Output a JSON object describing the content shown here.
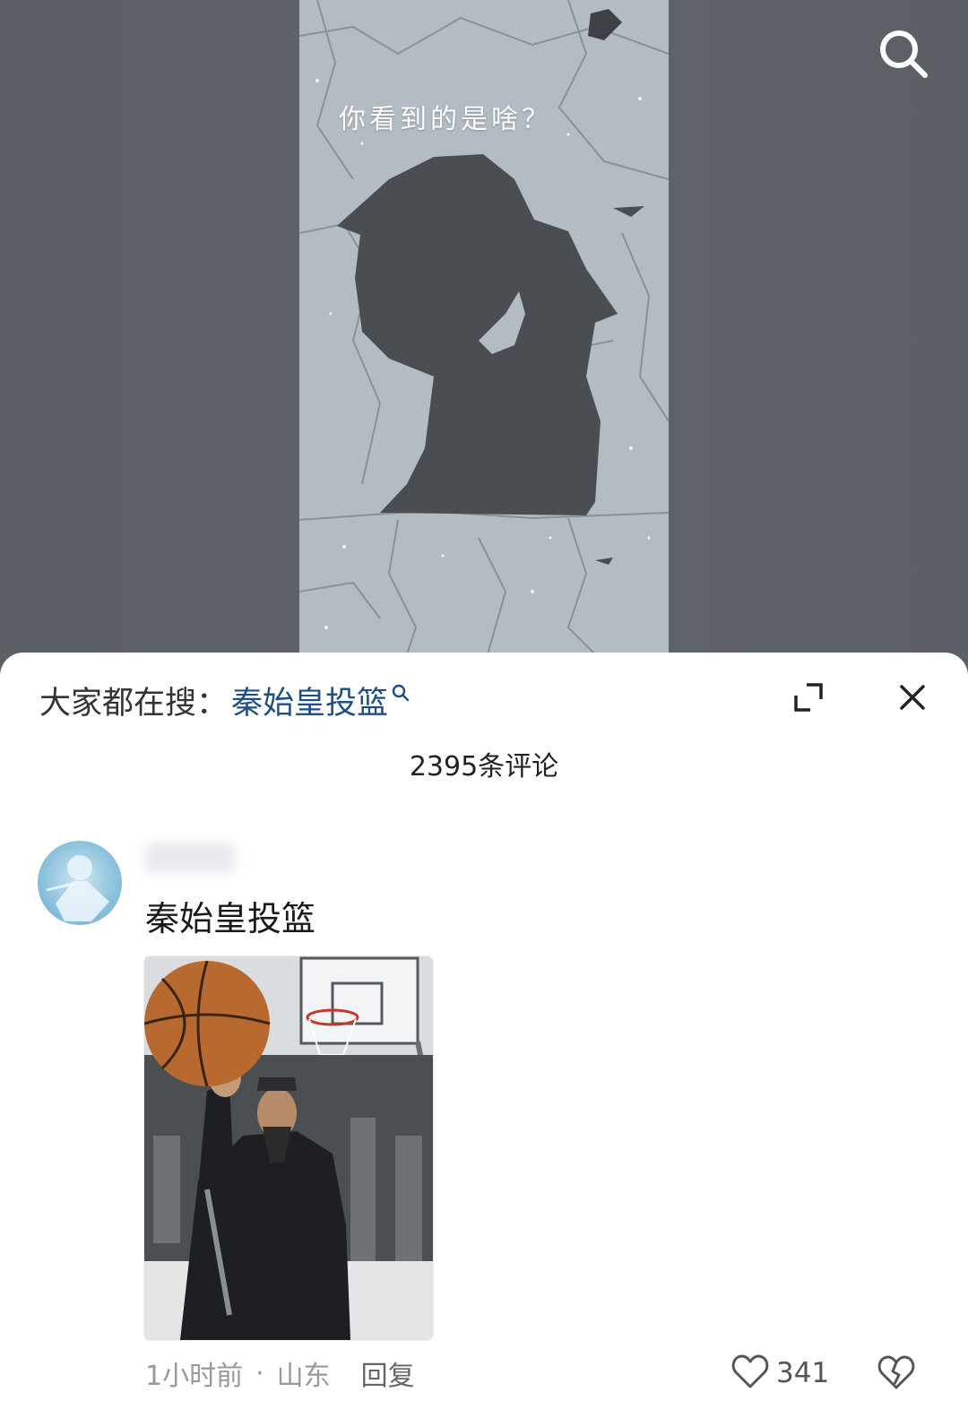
{
  "video": {
    "caption": "你看到的是啥？",
    "search_icon": "search-icon"
  },
  "comments_panel": {
    "hot_search": {
      "prefix": "大家都在搜：",
      "term": "秦始皇投篮",
      "term_color": "#1f4f84",
      "term_icon": "small-search-icon"
    },
    "expand_icon": "expand-icon",
    "close_icon": "close-icon",
    "comment_count_label": "2395条评论",
    "comments": [
      {
        "text": "秦始皇投篮",
        "image_description_icon": "basketball-meme-image",
        "time": "1小时前",
        "location": "山东",
        "separator": "·",
        "reply_label": "回复",
        "like_count": "341",
        "like_icon": "heart-icon",
        "dislike_icon": "broken-heart-icon"
      }
    ]
  }
}
